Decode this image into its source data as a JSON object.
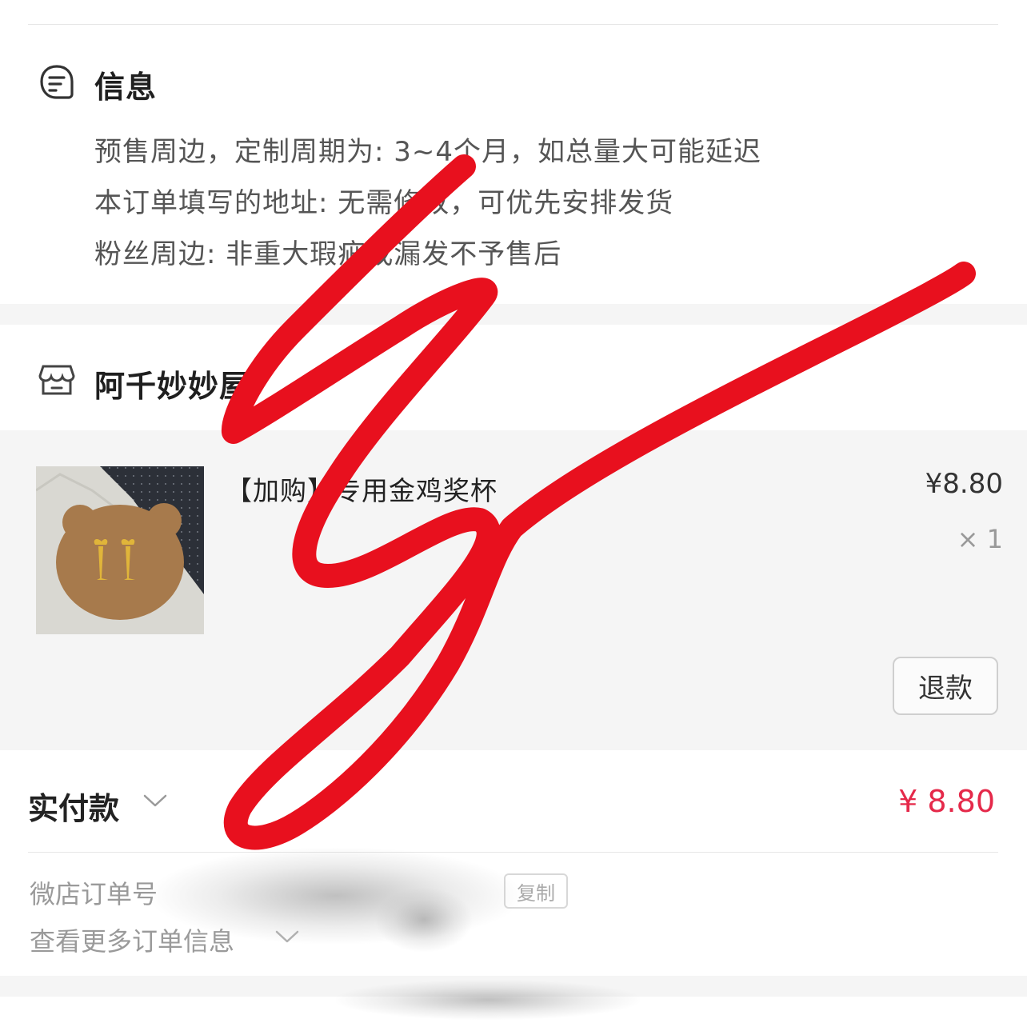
{
  "info": {
    "title": "信息",
    "icon": "note-icon",
    "lines": [
      "预售周边，定制周期为: 3~4个月，如总量大可能延迟",
      "本订单填写的地址: 无需修改，可优先安排发货",
      "粉丝周边: 非重大瑕疵或漏发不予售后"
    ]
  },
  "shop": {
    "name": "阿千妙妙屋",
    "icon": "store-icon"
  },
  "item": {
    "title": "【加购】专用金鸡奖杯",
    "price": "¥8.80",
    "quantity": "× 1",
    "refund_label": "退款"
  },
  "payment": {
    "label": "实付款",
    "amount": "¥ 8.80",
    "amount_color": "#e5294a"
  },
  "order": {
    "order_no_label": "微店订单号",
    "copy_label": "复制",
    "more_label": "查看更多订单信息"
  },
  "colors": {
    "scribble": "#e8101e",
    "band": "#f5f5f5"
  }
}
